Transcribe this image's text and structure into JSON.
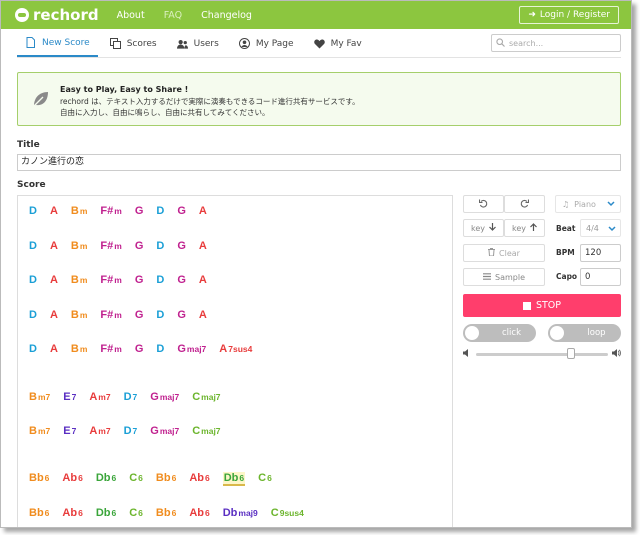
{
  "app": {
    "logo_text": "rechord"
  },
  "topnav": {
    "items": [
      "About",
      "FAQ",
      "Changelog"
    ],
    "login": "Login / Register"
  },
  "tabs": [
    {
      "label": "New Score",
      "icon": "document-icon"
    },
    {
      "label": "Scores",
      "icon": "copy-icon"
    },
    {
      "label": "Users",
      "icon": "users-icon"
    },
    {
      "label": "My Page",
      "icon": "user-circle-icon"
    },
    {
      "label": "My Fav",
      "icon": "heart-icon"
    }
  ],
  "search": {
    "placeholder": "search..."
  },
  "notice": {
    "title": "Easy to Play, Easy to Share !",
    "line1": "rechord は、テキスト入力するだけで実際に演奏もできるコード進行共有サービスです。",
    "line2": "自由に入力し、自由に鳴らし、自由に共有してみてください。"
  },
  "form": {
    "title_label": "Title",
    "title_value": "カノン進行の恋",
    "score_label": "Score"
  },
  "colors": {
    "D": "#1a9fd6",
    "A": "#e83c3c",
    "B": "#f08c1e",
    "F": "#c0218f",
    "G": "#c0218f",
    "E": "#5a2fc2",
    "C": "#6cb52d",
    "Db": "#3aa53a",
    "Dbmaj": "#5a2fc2",
    "Ab": "#e83c3c",
    "Bb": "#f08c1e"
  },
  "score": {
    "rows": [
      [
        [
          "D",
          ""
        ],
        [
          "A",
          ""
        ],
        [
          "B",
          "m"
        ],
        [
          "F#",
          "m"
        ],
        [
          "G",
          ""
        ],
        [
          "D",
          ""
        ],
        [
          "G",
          ""
        ],
        [
          "A",
          ""
        ]
      ],
      [
        [
          "D",
          ""
        ],
        [
          "A",
          ""
        ],
        [
          "B",
          "m"
        ],
        [
          "F#",
          "m"
        ],
        [
          "G",
          ""
        ],
        [
          "D",
          ""
        ],
        [
          "G",
          ""
        ],
        [
          "A",
          ""
        ]
      ],
      [
        [
          "D",
          ""
        ],
        [
          "A",
          ""
        ],
        [
          "B",
          "m"
        ],
        [
          "F#",
          "m"
        ],
        [
          "G",
          ""
        ],
        [
          "D",
          ""
        ],
        [
          "G",
          ""
        ],
        [
          "A",
          ""
        ]
      ],
      [
        [
          "D",
          ""
        ],
        [
          "A",
          ""
        ],
        [
          "B",
          "m"
        ],
        [
          "F#",
          "m"
        ],
        [
          "G",
          ""
        ],
        [
          "D",
          ""
        ],
        [
          "G",
          ""
        ],
        [
          "A",
          ""
        ]
      ],
      [
        [
          "D",
          ""
        ],
        [
          "A",
          ""
        ],
        [
          "B",
          "m"
        ],
        [
          "F#",
          "m"
        ],
        [
          "G",
          ""
        ],
        [
          "D",
          ""
        ],
        [
          "G",
          "maj7"
        ],
        [
          "A",
          "7sus4"
        ]
      ],
      [
        [
          "B",
          "m7"
        ],
        [
          "E",
          "7"
        ],
        [
          "A",
          "m7"
        ],
        [
          "D",
          "7"
        ],
        [
          "G",
          "maj7"
        ],
        [
          "C",
          "maj7"
        ]
      ],
      [
        [
          "B",
          "m7"
        ],
        [
          "E",
          "7"
        ],
        [
          "A",
          "m7"
        ],
        [
          "D",
          "7"
        ],
        [
          "G",
          "maj7"
        ],
        [
          "C",
          "maj7"
        ]
      ],
      [
        [
          "Bb",
          "6"
        ],
        [
          "Ab",
          "6"
        ],
        [
          "Db",
          "6"
        ],
        [
          "C",
          "6"
        ],
        [
          "Bb",
          "6"
        ],
        [
          "Ab",
          "6"
        ],
        [
          "Db",
          "6"
        ],
        [
          "C",
          "6"
        ]
      ],
      [
        [
          "Bb",
          "6"
        ],
        [
          "Ab",
          "6"
        ],
        [
          "Db",
          "6"
        ],
        [
          "C",
          "6"
        ],
        [
          "Bb",
          "6"
        ],
        [
          "Ab",
          "6"
        ],
        [
          "Db",
          "maj9"
        ],
        [
          "C",
          "9sus4"
        ]
      ]
    ],
    "highlight": {
      "row": 7,
      "index": 6
    }
  },
  "controls": {
    "instrument": "Piano",
    "key_down": "key",
    "key_up": "key",
    "beat_label": "Beat",
    "beat_value": "4/4",
    "clear": "Clear",
    "bpm_label": "BPM",
    "bpm_value": "120",
    "sample": "Sample",
    "capo_label": "Capo",
    "capo_value": "0",
    "stop": "STOP",
    "click": "click",
    "loop": "loop",
    "volume": 0.72
  }
}
